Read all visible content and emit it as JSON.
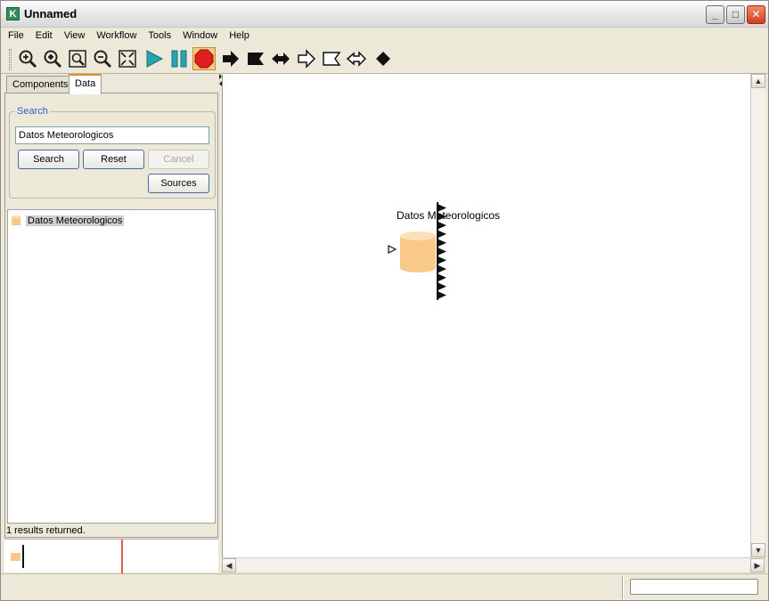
{
  "window": {
    "title": "Unnamed",
    "icon_letter": "K"
  },
  "menu": [
    "File",
    "Edit",
    "View",
    "Workflow",
    "Tools",
    "Window",
    "Help"
  ],
  "toolbar": {
    "icons": [
      "zoom-in-icon",
      "zoom-in-alt-icon",
      "zoom-fit-icon",
      "zoom-out-icon",
      "fit-window-icon",
      "run-icon",
      "pause-icon",
      "stop-icon",
      "step-arrow-icon",
      "step-flag-icon",
      "step-back-icon",
      "outline-arrow-icon",
      "outline-flag-icon",
      "outline-double-arrow-icon",
      "diamond-icon"
    ]
  },
  "tabs": [
    {
      "label": "Components"
    },
    {
      "label": "Data"
    }
  ],
  "search": {
    "legend": "Search",
    "query": "Datos Meteorologicos",
    "search_label": "Search",
    "reset_label": "Reset",
    "cancel_label": "Cancel",
    "sources_label": "Sources"
  },
  "results": {
    "items": [
      {
        "label": "Datos Meteorologicos"
      }
    ],
    "status": "1 results returned."
  },
  "canvas": {
    "node": {
      "title": "Datos Meteorologicos",
      "output_ports": 11
    }
  },
  "colors": {
    "accent": "#e68b2c",
    "node_fill": "#f9c98a",
    "run": "#2aa3b0",
    "stop": "#e02020"
  }
}
